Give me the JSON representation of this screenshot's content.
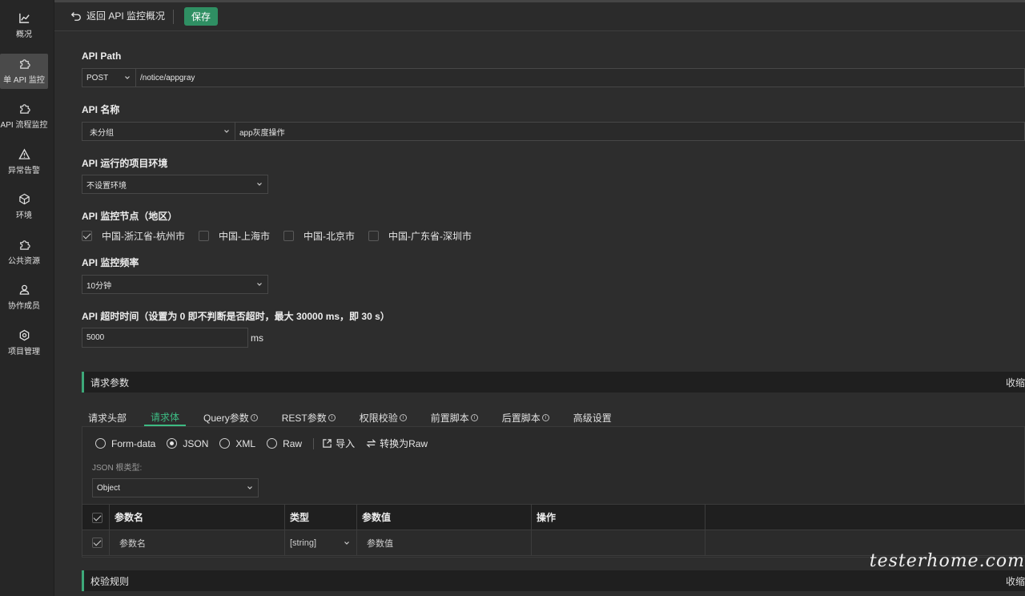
{
  "sidebar": {
    "items": [
      {
        "label": "概况",
        "icon": "chart-line-icon"
      },
      {
        "label": "单 API 监控",
        "icon": "puzzle-icon"
      },
      {
        "label": "API 流程监控",
        "icon": "puzzle-icon"
      },
      {
        "label": "异常告警",
        "icon": "warning-icon"
      },
      {
        "label": "环境",
        "icon": "cube-icon"
      },
      {
        "label": "公共资源",
        "icon": "puzzle-icon"
      },
      {
        "label": "协作成员",
        "icon": "user-icon"
      },
      {
        "label": "项目管理",
        "icon": "gear-icon"
      }
    ],
    "active_index": 1
  },
  "topbar": {
    "back_label": "返回 API 监控概况",
    "save_label": "保存"
  },
  "form": {
    "api_path_label": "API Path",
    "method": "POST",
    "path": "/notice/appgray",
    "api_name_label": "API 名称",
    "group": "未分组",
    "name": "app灰度操作",
    "env_label": "API 运行的项目环境",
    "env": "不设置环境",
    "nodes_label": "API 监控节点（地区）",
    "regions": [
      {
        "label": "中国-浙江省-杭州市",
        "checked": true
      },
      {
        "label": "中国-上海市",
        "checked": false
      },
      {
        "label": "中国-北京市",
        "checked": false
      },
      {
        "label": "中国-广东省-深圳市",
        "checked": false
      }
    ],
    "freq_label": "API 监控频率",
    "freq": "10分钟",
    "timeout_label": "API 超时时间（设置为 0 即不判断是否超时，最大 30000 ms，即 30 s）",
    "timeout": "5000",
    "timeout_unit": "ms"
  },
  "request_section": {
    "title": "请求参数",
    "collapse_label": "收缩",
    "tabs": [
      "请求头部",
      "请求体",
      "Query参数",
      "REST参数",
      "权限校验",
      "前置脚本",
      "后置脚本",
      "高级设置"
    ],
    "active_tab": 1,
    "body_types": [
      "Form-data",
      "JSON",
      "XML",
      "Raw"
    ],
    "selected_body_type": "JSON",
    "import_label": "导入",
    "convert_label": "转换为Raw",
    "json_root_label": "JSON 根类型:",
    "json_root": "Object",
    "table": {
      "headers": [
        "参数名",
        "类型",
        "参数值",
        "操作"
      ],
      "rows": [
        {
          "name": "参数名",
          "type": "[string]",
          "value": "参数值"
        }
      ]
    }
  },
  "validation_section": {
    "title": "校验规则",
    "collapse_label": "收缩"
  },
  "watermark": "testerhome.com",
  "colors": {
    "accent": "#3dbb83",
    "save_button": "#2f8f63",
    "background": "#2d2d2d"
  }
}
